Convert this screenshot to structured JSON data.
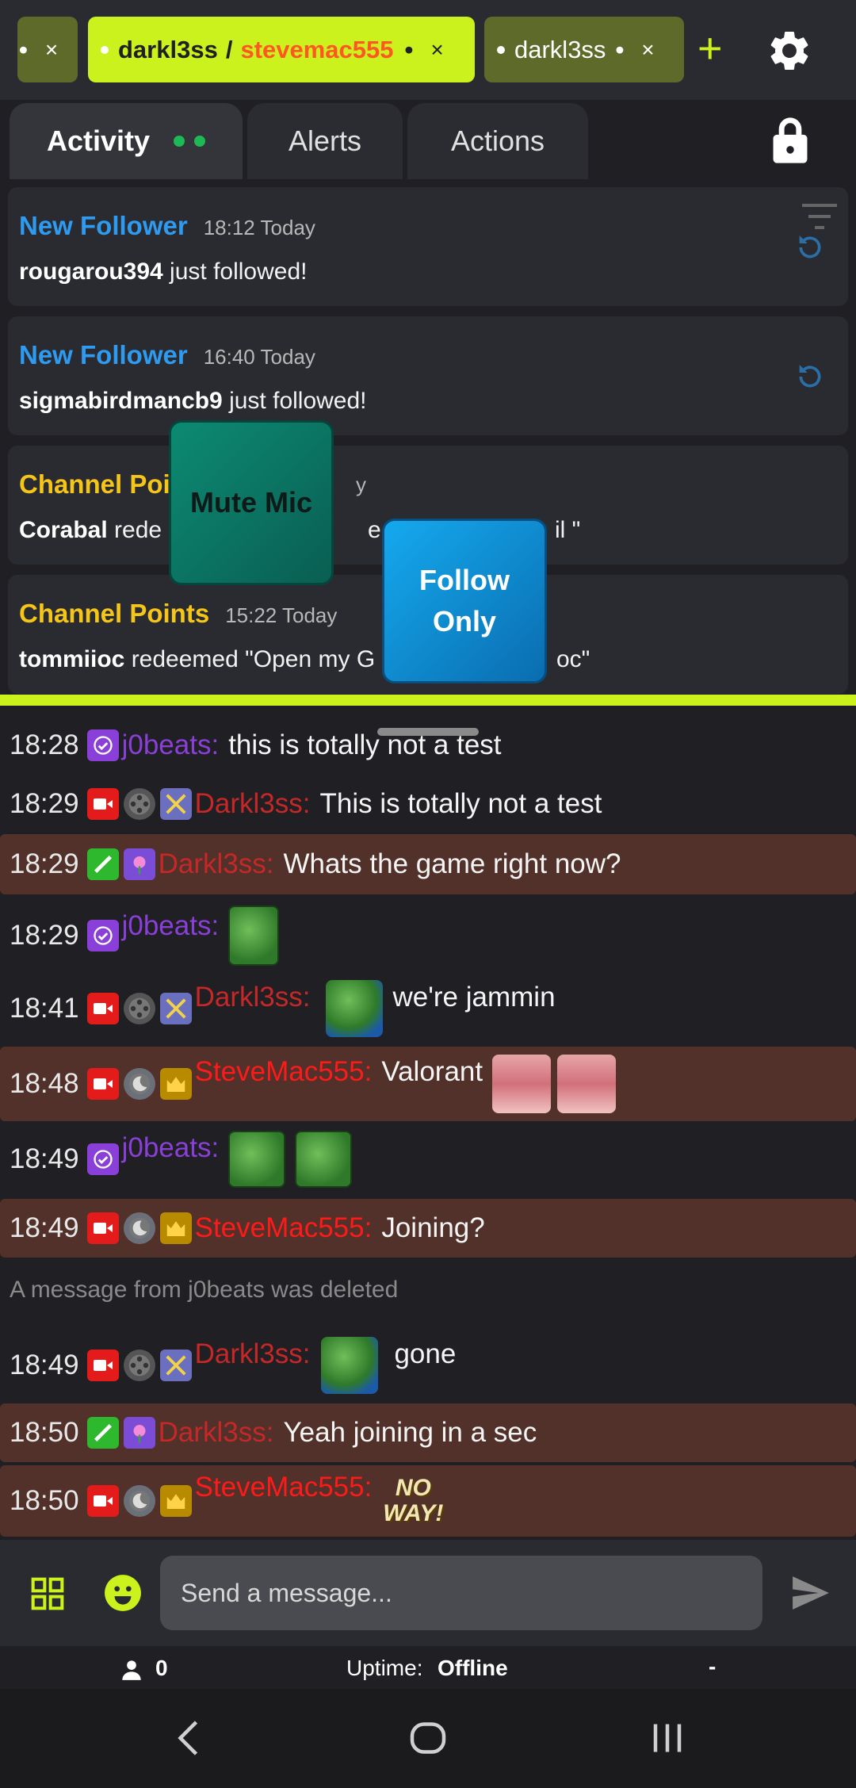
{
  "chat_tabs": [
    {
      "label": "",
      "close": "×",
      "dot": "•"
    },
    {
      "label_user": "darkl3ss",
      "separator": "/",
      "label_other": "stevemac555",
      "close": "×",
      "dot": "•",
      "mid_dot": "•"
    },
    {
      "label": "darkl3ss",
      "close": "×",
      "dot": "•"
    }
  ],
  "add_tab_label": "+",
  "panel_tabs": [
    {
      "label": "Activity"
    },
    {
      "label": "Alerts"
    },
    {
      "label": "Actions"
    }
  ],
  "activity": [
    {
      "type": "New Follower",
      "time": "18:12 Today",
      "user": "rougarou394",
      "text": " just followed!"
    },
    {
      "type": "New Follower",
      "time": "16:40 Today",
      "user": "sigmabirdmancb9",
      "text": " just followed!"
    },
    {
      "type": "Channel Poi",
      "time": "y",
      "user": "Corabal",
      "text_a": " rede",
      "text_b": "e a G",
      "text_c": "il \""
    },
    {
      "type": "Channel Points",
      "time": "15:22 Today",
      "user": "tommiioc",
      "text_a": " redeemed \"Open my G",
      "text_b": "oc\""
    }
  ],
  "floating_buttons": {
    "mute_mic": "Mute Mic",
    "follow_only_1": "Follow",
    "follow_only_2": "Only"
  },
  "chat": [
    {
      "time": "18:28",
      "user": "j0beats:",
      "text": "this is totally not a test"
    },
    {
      "time": "18:29",
      "user": "Darkl3ss:",
      "text": "This is totally not a test"
    },
    {
      "time": "18:29",
      "user": "Darkl3ss:",
      "text": "Whats the game right now?"
    },
    {
      "time": "18:29",
      "user": "j0beats:",
      "text": ""
    },
    {
      "time": "18:41",
      "user": "Darkl3ss:",
      "text": "we're jammin"
    },
    {
      "time": "18:48",
      "user": "SteveMac555:",
      "text": "Valorant"
    },
    {
      "time": "18:49",
      "user": "j0beats:",
      "text": ""
    },
    {
      "time": "18:49",
      "user": "SteveMac555:",
      "text": "Joining?"
    },
    {
      "time": "18:49",
      "user": "Darkl3ss:",
      "text": "gone"
    },
    {
      "time": "18:50",
      "user": "Darkl3ss:",
      "text": "Yeah joining in a sec"
    },
    {
      "time": "18:50",
      "user": "SteveMac555:",
      "text": ""
    }
  ],
  "deleted_notice": "A message from j0beats was deleted",
  "emote_noway": {
    "line1": "NO",
    "line2": "WAY!"
  },
  "input": {
    "placeholder": "Send a message..."
  },
  "status": {
    "viewer_count": "0",
    "uptime_label": "Uptime:",
    "uptime_value": "Offline",
    "dash": "-"
  },
  "colors": {
    "accent": "#ccf21e",
    "follower": "#2f9bf0",
    "channel_points": "#f5c518",
    "highlight_row": "#51312a"
  }
}
